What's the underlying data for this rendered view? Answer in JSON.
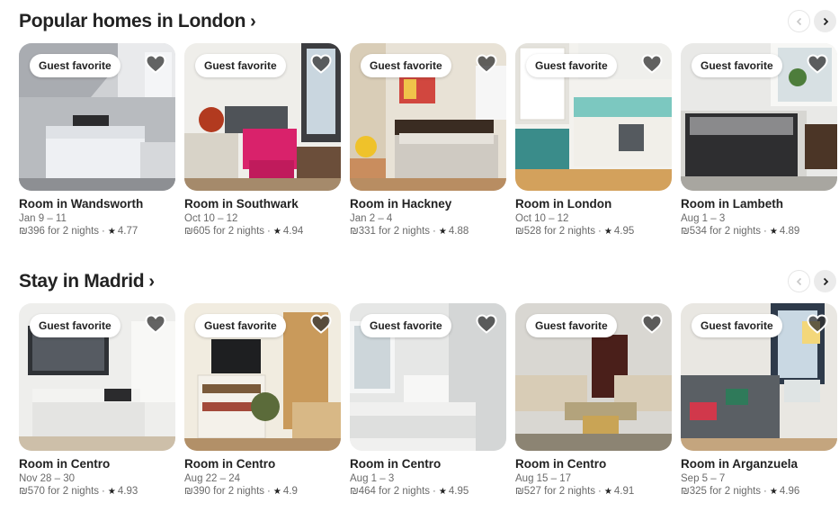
{
  "sections": [
    {
      "title": "Popular homes in London",
      "chevron": "›",
      "nav": {
        "prev_icon": "chevron-left-icon",
        "next_icon": "chevron-right-icon"
      },
      "listings": [
        {
          "badge": "Guest favorite",
          "title": "Room in Wandsworth",
          "dates": "Jan 9 – 11",
          "price": "₪396 for 2 nights",
          "rating": "4.77"
        },
        {
          "badge": "Guest favorite",
          "title": "Room in Southwark",
          "dates": "Oct 10 – 12",
          "price": "₪605 for 2 nights",
          "rating": "4.94"
        },
        {
          "badge": "Guest favorite",
          "title": "Room in Hackney",
          "dates": "Jan 2 – 4",
          "price": "₪331 for 2 nights",
          "rating": "4.88"
        },
        {
          "badge": "Guest favorite",
          "title": "Room in London",
          "dates": "Oct 10 – 12",
          "price": "₪528 for 2 nights",
          "rating": "4.95"
        },
        {
          "badge": "Guest favorite",
          "title": "Room in Lambeth",
          "dates": "Aug 1 – 3",
          "price": "₪534 for 2 nights",
          "rating": "4.89"
        }
      ]
    },
    {
      "title": "Stay in Madrid",
      "chevron": "›",
      "nav": {
        "prev_icon": "chevron-left-icon",
        "next_icon": "chevron-right-icon"
      },
      "listings": [
        {
          "badge": "Guest favorite",
          "title": "Room in Centro",
          "dates": "Nov 28 – 30",
          "price": "₪570 for 2 nights",
          "rating": "4.93"
        },
        {
          "badge": "Guest favorite",
          "title": "Room in Centro",
          "dates": "Aug 22 – 24",
          "price": "₪390 for 2 nights",
          "rating": "4.9"
        },
        {
          "badge": "Guest favorite",
          "title": "Room in Centro",
          "dates": "Aug 1 – 3",
          "price": "₪464 for 2 nights",
          "rating": "4.95"
        },
        {
          "badge": "Guest favorite",
          "title": "Room in Centro",
          "dates": "Aug 15 – 17",
          "price": "₪527 for 2 nights",
          "rating": "4.91"
        },
        {
          "badge": "Guest favorite",
          "title": "Room in Arganzuela",
          "dates": "Sep 5 – 7",
          "price": "₪325 for 2 nights",
          "rating": "4.96"
        }
      ]
    }
  ],
  "separator": "·",
  "star_glyph": "★",
  "colors": {
    "text": "#222222",
    "muted": "#6a6a6a",
    "heart_fill": "#3a3a3a"
  }
}
